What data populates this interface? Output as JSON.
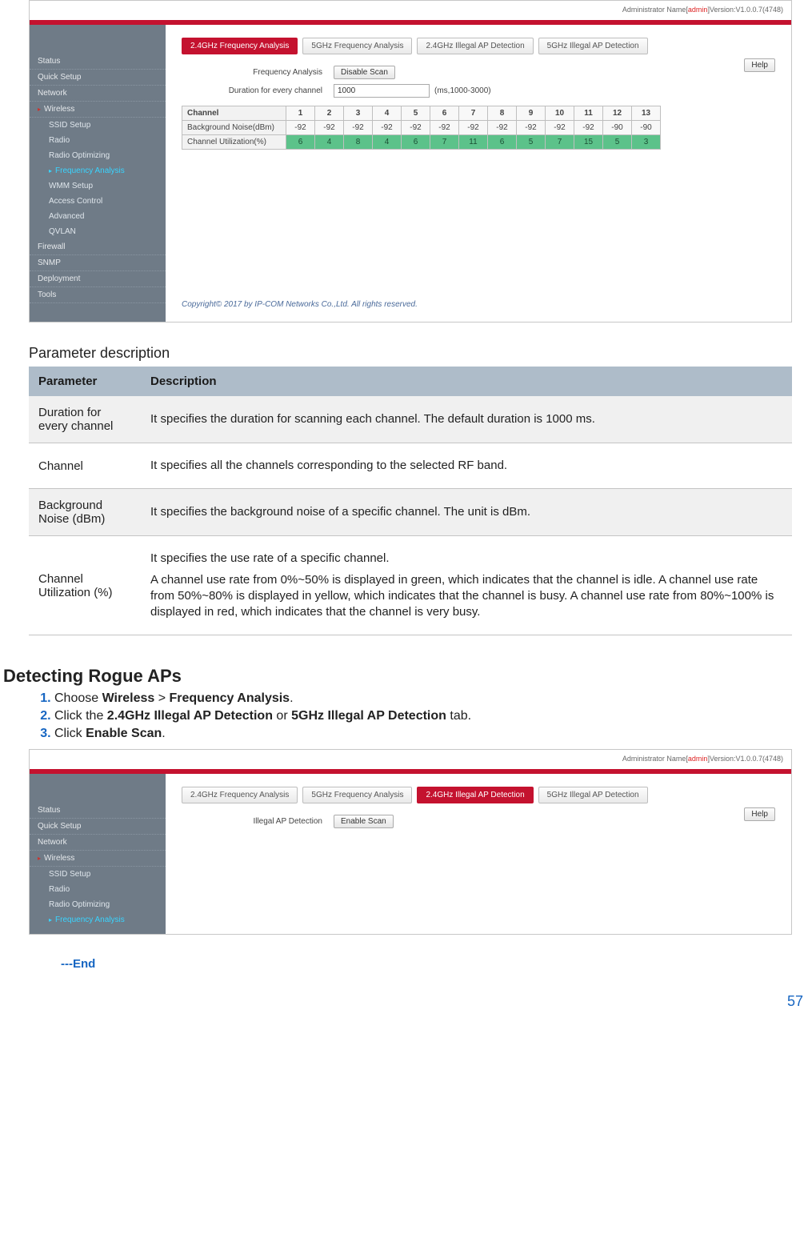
{
  "admin_header": {
    "prefix": "Administrator Name[",
    "name": "admin",
    "suffix": "]Version:V1.0.0.7(4748)"
  },
  "sidebar_top": [
    "Status",
    "Quick Setup",
    "Network"
  ],
  "sidebar_wireless_label": "Wireless",
  "sidebar_wireless_children": [
    "SSID Setup",
    "Radio",
    "Radio Optimizing",
    "Frequency Analysis",
    "WMM Setup",
    "Access Control",
    "Advanced",
    "QVLAN"
  ],
  "sidebar_bottom": [
    "Firewall",
    "SNMP",
    "Deployment",
    "Tools"
  ],
  "tabs": [
    "2.4GHz Frequency Analysis",
    "5GHz Frequency Analysis",
    "2.4GHz Illegal AP Detection",
    "5GHz Illegal AP Detection"
  ],
  "shot1_active_tab_index": 0,
  "shot2_active_tab_index": 2,
  "shot1": {
    "freq_label": "Frequency Analysis",
    "scan_button": "Disable Scan",
    "duration_label": "Duration for every channel",
    "duration_value": "1000",
    "duration_hint": "(ms,1000-3000)",
    "help": "Help"
  },
  "shot2": {
    "illegal_label": "Illegal AP Detection",
    "scan_button": "Enable Scan",
    "help": "Help"
  },
  "footer_copyright": "Copyright© 2017 by IP-COM Networks Co.,Ltd. All rights reserved.",
  "chart_data": {
    "type": "table",
    "title": "Channel scan results",
    "columns": [
      "Channel",
      "1",
      "2",
      "3",
      "4",
      "5",
      "6",
      "7",
      "8",
      "9",
      "10",
      "11",
      "12",
      "13"
    ],
    "rows": [
      {
        "name": "Background Noise(dBm)",
        "values": [
          -92,
          -92,
          -92,
          -92,
          -92,
          -92,
          -92,
          -92,
          -92,
          -92,
          -92,
          -90,
          -90
        ]
      },
      {
        "name": "Channel Utilization(%)",
        "values": [
          6,
          4,
          8,
          4,
          6,
          7,
          11,
          6,
          5,
          7,
          15,
          5,
          3
        ]
      }
    ]
  },
  "param_section_title": "Parameter description",
  "param_headers": {
    "p": "Parameter",
    "d": "Description"
  },
  "param_rows": [
    {
      "p": "Duration for every channel",
      "d": [
        "It specifies the duration for scanning each channel. The default duration is 1000 ms."
      ]
    },
    {
      "p": "Channel",
      "d": [
        "It specifies all the channels corresponding to the selected RF band."
      ]
    },
    {
      "p": "Background Noise (dBm)",
      "d": [
        "It specifies the background noise of a specific channel. The unit is dBm."
      ]
    },
    {
      "p": "Channel Utilization (%)",
      "d": [
        "It specifies the use rate of a specific channel.",
        "A channel use rate from 0%~50% is displayed in green, which indicates that the channel is idle. A channel use rate from 50%~80% is displayed in yellow, which indicates that the channel is busy. A channel use rate from 80%~100% is displayed in red, which indicates that the channel is very busy."
      ]
    }
  ],
  "h2": "Detecting Rogue APs",
  "steps_html": [
    "Choose <b>Wireless</b> > <b>Frequency Analysis</b>.",
    "Click the <b>2.4GHz Illegal AP Detection</b> or <b>5GHz Illegal AP Detection</b> tab.",
    "Click <b>Enable Scan</b>."
  ],
  "end_marker": "---End",
  "page_number": "57"
}
